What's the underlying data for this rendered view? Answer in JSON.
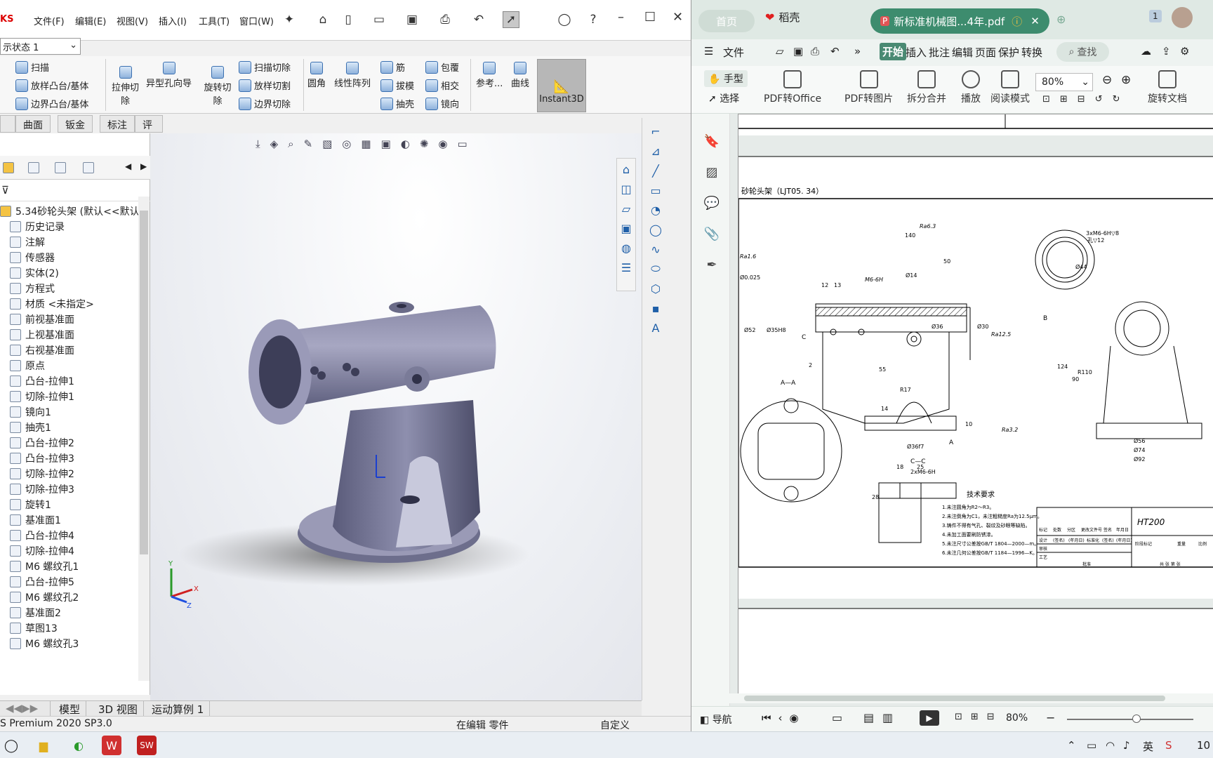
{
  "solidworks": {
    "brand": "KS",
    "menu": [
      "文件(F)",
      "编辑(E)",
      "视图(V)",
      "插入(I)",
      "工具(T)",
      "窗口(W)"
    ],
    "config_state": "示状态 1",
    "ribbon": {
      "sweep_boss": "扫描",
      "loft_boss": "放样凸台/基体",
      "boundary_boss": "边界凸台/基体",
      "extruded_cut": "拉伸切除",
      "hole_wizard": "异型孔向导",
      "revolved_cut": "旋转切除",
      "swept_cut": "扫描切除",
      "lofted_cut": "放样切割",
      "boundary_cut": "边界切除",
      "fillet": "圆角",
      "linear_pattern": "线性阵列",
      "rib": "筋",
      "draft": "拔模",
      "shell": "抽壳",
      "wrap": "包覆",
      "intersect": "相交",
      "mirror": "镜向",
      "reference": "参考...",
      "curves": "曲线",
      "instant3d": "Instant3D"
    },
    "cmd_tabs": [
      "曲面",
      "钣金",
      "标注",
      "评估"
    ],
    "tree": {
      "root": "5.34砂轮头架 (默认<<默认",
      "items": [
        "历史记录",
        "注解",
        "传感器",
        "实体(2)",
        "方程式",
        "材质 <未指定>",
        "前视基准面",
        "上视基准面",
        "右视基准面",
        "原点",
        "凸台-拉伸1",
        "切除-拉伸1",
        "镜向1",
        "抽壳1",
        "凸台-拉伸2",
        "凸台-拉伸3",
        "切除-拉伸2",
        "切除-拉伸3",
        "旋转1",
        "基准面1",
        "凸台-拉伸4",
        "切除-拉伸4",
        "M6 螺纹孔1",
        "凸台-拉伸5",
        "M6 螺纹孔2",
        "基准面2",
        "草图13",
        "M6 螺纹孔3"
      ]
    },
    "bottom_tabs": [
      "模型",
      "3D 视图",
      "运动算例 1"
    ],
    "status": {
      "version": "S Premium 2020 SP3.0",
      "editing": "在编辑 零件",
      "custom": "自定义"
    }
  },
  "pdf": {
    "tabs": {
      "home": "首页",
      "docer": "稻壳",
      "file": "新标准机械图...4年.pdf"
    },
    "menu": [
      "文件",
      "开始",
      "插入",
      "批注",
      "编辑",
      "页面",
      "保护",
      "转换"
    ],
    "search": "查找",
    "tools": {
      "hand": "手型",
      "select": "选择",
      "pdf_office": "PDF转Office",
      "pdf_image": "PDF转图片",
      "split_merge": "拆分合并",
      "play": "播放",
      "reading": "阅读模式",
      "rotate": "旋转文档",
      "zoom": "80%"
    },
    "status": {
      "nav": "导航",
      "zoom": "80%"
    },
    "drawing": {
      "title": "砂轮头架（LJT05. 34）",
      "tech_title": "技术要求",
      "tech": [
        "1.未注圆角为R2～R3。",
        "2.未注倒角为C1，未注粗糙度Ra为12.5μm。",
        "3.铸件不得有气孔、裂纹及砂眼等缺陷。",
        "4.未加工面要刷防锈漆。",
        "5.未注尺寸公差按GB/T 1804—2000—m。",
        "6.未注几何公差按GB/T 1184—1996—K。"
      ],
      "material": "HT200",
      "section_aa": "A—A",
      "section_cc": "C—C",
      "dims": [
        "140",
        "50",
        "55",
        "12",
        "13",
        "2",
        "R17",
        "14",
        "10",
        "25",
        "18",
        "28",
        "Ra6.3",
        "Ra1.6",
        "Ra12.5",
        "Ra3.2",
        "M6-6H",
        "Ø14",
        "Ø36",
        "Ø30",
        "Ø35H8",
        "Ø52",
        "Ø36f7",
        "Ø44",
        "Ø56",
        "Ø74",
        "Ø92",
        "R110",
        "124",
        "90",
        "3xM6-6H▽8",
        "孔▽12",
        "2xM6-6H",
        "Ø0.025",
        "B",
        "A",
        "C"
      ],
      "table_header": [
        "标记",
        "处数",
        "分区",
        "更改文件号",
        "签名",
        "年月日"
      ],
      "table_rows": [
        "设计",
        "审核",
        "工艺",
        "批准",
        "共 张 第 张",
        "阶段标记",
        "重量",
        "比例"
      ],
      "table_fill": [
        "(签名)",
        "(年月日)",
        "标准化",
        "(签名)",
        "(年月日)"
      ]
    }
  },
  "taskbar": {
    "tray": [
      "英",
      "10"
    ]
  }
}
